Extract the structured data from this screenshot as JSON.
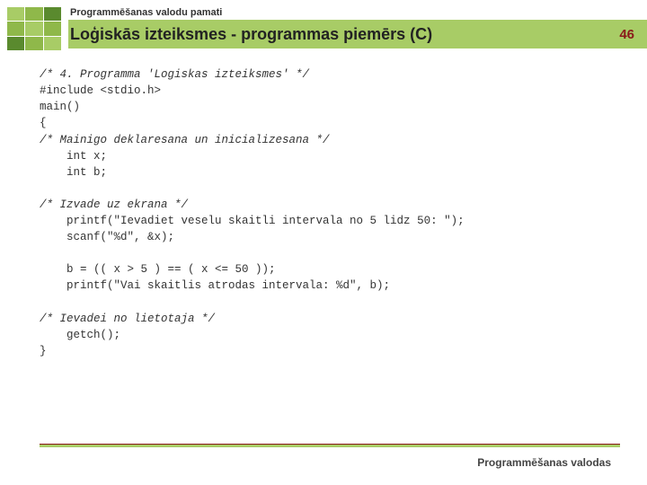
{
  "header": {
    "course": "Programmēšanas valodu pamati",
    "title": "Loģiskās izteiksmes - programmas piemērs (C)",
    "slide_number": "46"
  },
  "code": {
    "b1_l1": "/* 4. Programma 'Logiskas izteiksmes' */",
    "b1_l2": "#include <stdio.h>",
    "b1_l3": "main()",
    "b1_l4": "{",
    "b1_l5": "/* Mainigo deklaresana un inicializesana */",
    "b1_l6": "int x;",
    "b1_l7": "int b;",
    "b2_l1": "/* Izvade uz ekrana */",
    "b2_l2": "printf(\"Ievadiet veselu skaitli intervala no 5 lidz 50: \");",
    "b2_l3": "scanf(\"%d\", &x);",
    "b3_l1": "b = (( x > 5 ) == ( x <= 50 ));",
    "b3_l2": "printf(\"Vai skaitlis atrodas intervala: %d\", b);",
    "b4_l1": "/* Ievadei no lietotaja */",
    "b4_l2": "getch();",
    "b4_l3": "}"
  },
  "footer": {
    "text": "Programmēšanas valodas"
  }
}
